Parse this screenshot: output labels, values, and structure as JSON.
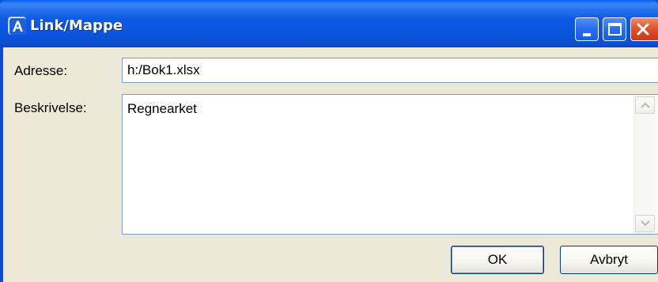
{
  "window": {
    "title": "Link/Mappe",
    "app_icon_letter": "A"
  },
  "form": {
    "address_label": "Adresse:",
    "address_value": "h:/Bok1.xlsx",
    "description_label": "Beskrivelse:",
    "description_value": "Regnearket"
  },
  "buttons": {
    "ok_label": "OK",
    "cancel_label": "Avbryt"
  },
  "icons": {
    "app": "app-a-icon",
    "minimize": "minimize-icon",
    "maximize": "maximize-icon",
    "close": "close-icon",
    "scroll_up": "chevron-up-icon",
    "scroll_down": "chevron-down-icon"
  },
  "colors": {
    "titlebar": "#0a55e0",
    "client_bg": "#ece9d8",
    "close_button": "#e1532b",
    "input_border": "#7f9db9"
  }
}
